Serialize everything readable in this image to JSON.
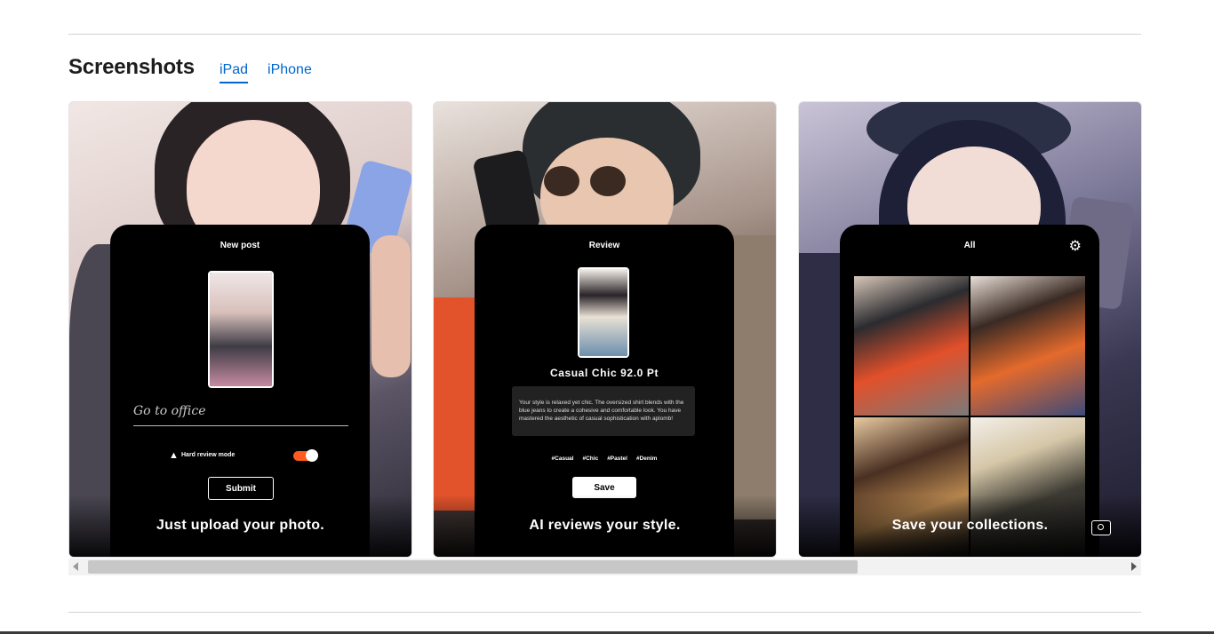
{
  "section": {
    "title": "Screenshots",
    "tabs": [
      {
        "label": "iPad",
        "active": true
      },
      {
        "label": "iPhone",
        "active": false
      }
    ]
  },
  "screenshots": [
    {
      "panel_title": "New post",
      "caption_placeholder": "Go to office",
      "toggle_label": "Hard review mode",
      "button_label": "Submit",
      "caption": "Just upload your photo."
    },
    {
      "panel_title": "Review",
      "score": "Casual Chic 92.0 Pt",
      "review_text": "Your style is relaxed yet chic. The oversized shirt blends with the blue jeans to create a cohesive and comfortable look. You have mastered the aesthetic of casual sophistication with aplomb!",
      "tags": [
        "#Casual",
        "#Chic",
        "#Pastel",
        "#Denim"
      ],
      "button_label": "Save",
      "caption": "AI reviews your style."
    },
    {
      "panel_title": "All",
      "caption": "Save your collections."
    }
  ],
  "icons": {
    "settings": "gear-icon",
    "camera": "camera-icon",
    "hard_mode": "fire-icon"
  },
  "colors": {
    "link": "#0066cc",
    "toggle_on": "#ff5a1f"
  }
}
